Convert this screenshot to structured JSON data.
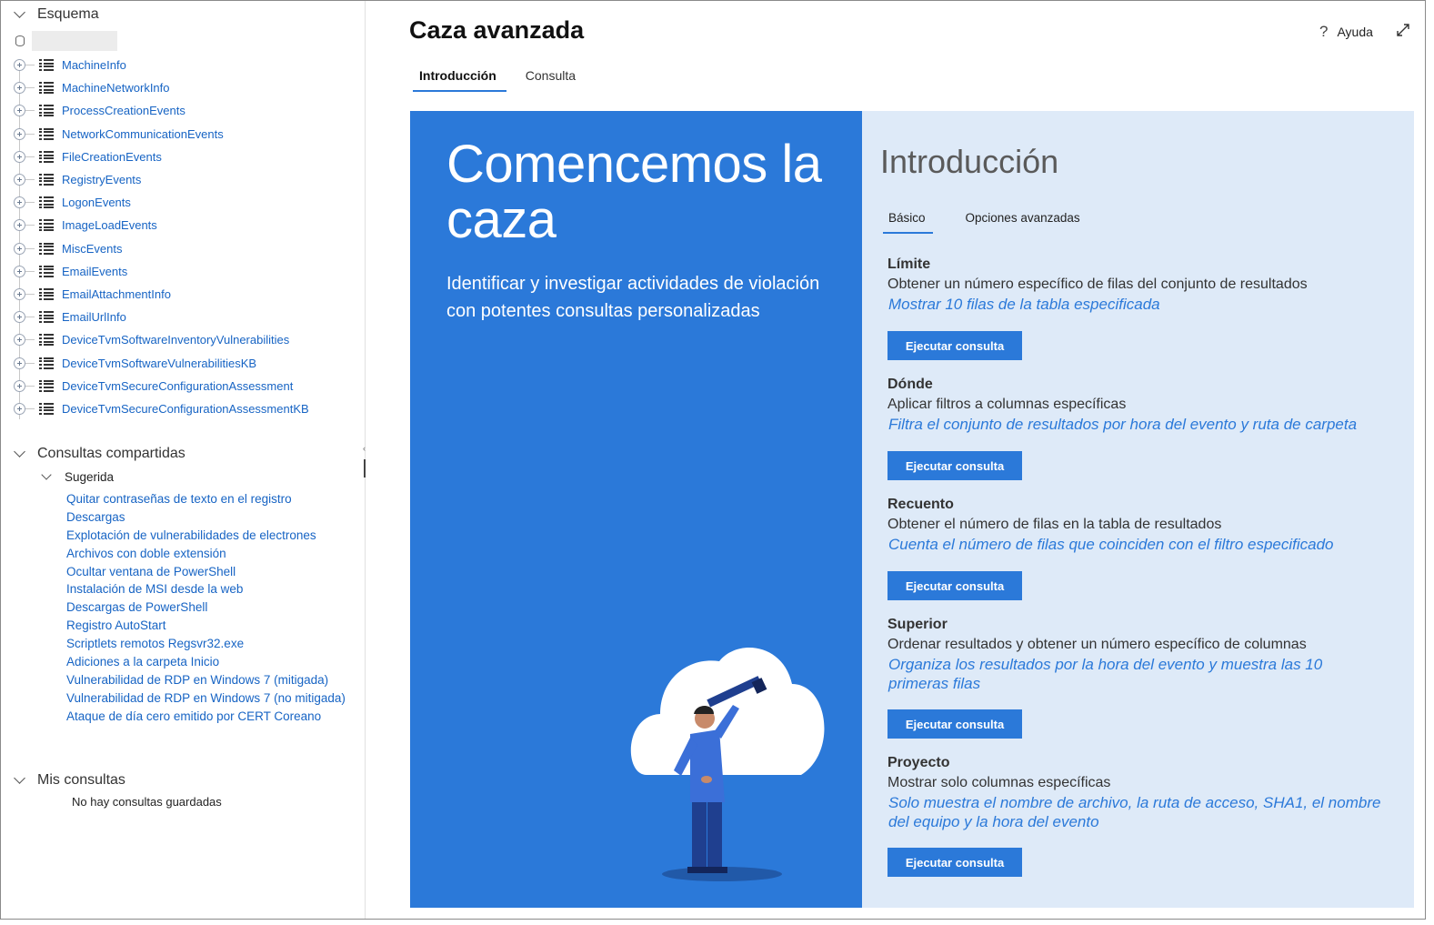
{
  "left_pane": {
    "schema": {
      "header": "Esquema",
      "tables": [
        "MachineInfo",
        "MachineNetworkInfo",
        "ProcessCreationEvents",
        "NetworkCommunicationEvents",
        "FileCreationEvents",
        "RegistryEvents",
        "LogonEvents",
        "ImageLoadEvents",
        "MiscEvents",
        "EmailEvents",
        "EmailAttachmentInfo",
        "EmailUrlInfo",
        "DeviceTvmSoftwareInventoryVulnerabilities",
        "DeviceTvmSoftwareVulnerabilitiesKB",
        "DeviceTvmSecureConfigurationAssessment",
        "DeviceTvmSecureConfigurationAssessmentKB"
      ]
    },
    "shared_queries": {
      "header": "Consultas compartidas",
      "suggested_header": "Sugerida",
      "items": [
        "Quitar contraseñas de texto en el registro",
        "Descargas",
        "Explotación de vulnerabilidades de electrones",
        "Archivos con doble extensión",
        "Ocultar ventana de PowerShell",
        "Instalación de MSI desde la web",
        "Descargas de PowerShell",
        "Registro AutoStart",
        "Scriptlets remotos Regsvr32.exe",
        "Adiciones a la carpeta Inicio",
        "Vulnerabilidad de RDP en Windows 7 (mitigada)",
        "Vulnerabilidad de RDP en Windows 7 (no mitigada)",
        "Ataque de día cero emitido por CERT Coreano"
      ]
    },
    "my_queries": {
      "header": "Mis consultas",
      "empty_text": "No hay consultas guardadas"
    }
  },
  "header": {
    "title": "Caza avanzada",
    "help_label": "Ayuda",
    "tabs": [
      "Introducción",
      "Consulta"
    ]
  },
  "hero": {
    "title": "Comencemos la caza",
    "subtitle": "Identificar y investigar actividades de violación con potentes consultas personalizadas"
  },
  "intro": {
    "title": "Introducción",
    "tabs": [
      "Básico",
      "Opciones avanzadas"
    ],
    "run_label": "Ejecutar consulta",
    "blocks": [
      {
        "title": "Límite",
        "desc": "Obtener un número específico de filas del conjunto de resultados",
        "link": "Mostrar 10 filas de la tabla especificada"
      },
      {
        "title": "Dónde",
        "desc": "Aplicar filtros a columnas específicas",
        "link": "Filtra el conjunto de resultados por hora del evento y ruta de carpeta"
      },
      {
        "title": "Recuento",
        "desc": "Obtener el número de filas en la tabla de resultados",
        "link": "Cuenta el número de filas que coinciden con el filtro especificado"
      },
      {
        "title": "Superior",
        "desc": "Ordenar resultados y obtener un número específico de columnas",
        "link": "Organiza los resultados por la hora del evento y muestra las 10 primeras filas"
      },
      {
        "title": "Proyecto",
        "desc": "Mostrar solo columnas específicas",
        "link": "Solo muestra el nombre de archivo, la ruta de acceso, SHA1, el nombre del equipo y la hora del evento"
      }
    ]
  },
  "colors": {
    "accent": "#2b79d9",
    "link": "#1764c4",
    "intro_bg": "#deeaf8"
  }
}
